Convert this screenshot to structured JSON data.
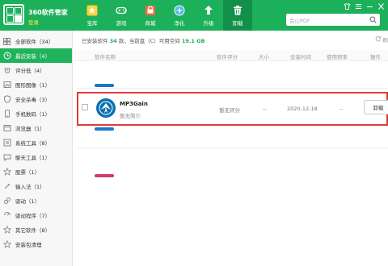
{
  "header": {
    "app_title": "360软件管家",
    "login_label": "登录",
    "nav": [
      {
        "label": "宝库",
        "icon": "star-icon"
      },
      {
        "label": "游戏",
        "icon": "gamepad-icon"
      },
      {
        "label": "商城",
        "icon": "shop-bag-icon"
      },
      {
        "label": "净化",
        "icon": "clean-compass-icon"
      },
      {
        "label": "升级",
        "icon": "upgrade-arrow-icon"
      },
      {
        "label": "卸载",
        "icon": "trash-icon"
      }
    ],
    "active_nav": "卸载",
    "colors": {
      "brand": "#1db05a",
      "active_tab": "#12904a"
    }
  },
  "search": {
    "placeholder": "",
    "value": "会山PDF"
  },
  "sidebar": {
    "items": [
      {
        "label": "全部软件（34）",
        "icon": "grid-icon"
      },
      {
        "label": "最近安装（4）",
        "icon": "clock-icon"
      },
      {
        "label": "评分低（4）",
        "icon": "low-rating-icon"
      },
      {
        "label": "图形图像（1）",
        "icon": "image-icon"
      },
      {
        "label": "安全杀毒（3）",
        "icon": "shield-icon"
      },
      {
        "label": "手机数码（1）",
        "icon": "phone-icon"
      },
      {
        "label": "浏览器（1）",
        "icon": "browser-icon"
      },
      {
        "label": "系统工具（8）",
        "icon": "tools-icon"
      },
      {
        "label": "聊天工具（1）",
        "icon": "chat-icon"
      },
      {
        "label": "股票（1）",
        "icon": "star-outline-icon"
      },
      {
        "label": "输入法（1）",
        "icon": "keyboard-icon"
      },
      {
        "label": "驱动（1）",
        "icon": "link-icon"
      },
      {
        "label": "驱动程序（7）",
        "icon": "driver-icon"
      },
      {
        "label": "其它软件（8）",
        "icon": "star-outline-icon"
      },
      {
        "label": "安装包清理",
        "icon": "star-outline-icon"
      }
    ],
    "active_index": 1
  },
  "summary": {
    "prefix": "已安装软件",
    "count": "34",
    "middle": "款，当前盘（C）可用空间",
    "space": "19.1 GB"
  },
  "refresh_label": "刷",
  "columns": {
    "name": "软件名称",
    "rating": "软件评分",
    "size": "大小",
    "date": "安装时间",
    "freq": "使用频率",
    "action": "操作"
  },
  "highlighted_app": {
    "name": "MP3Gain",
    "desc": "暂无简介",
    "rating": "暂无评分",
    "size": "--",
    "date": "2020-12-18",
    "freq": "--",
    "action": "卸载"
  }
}
